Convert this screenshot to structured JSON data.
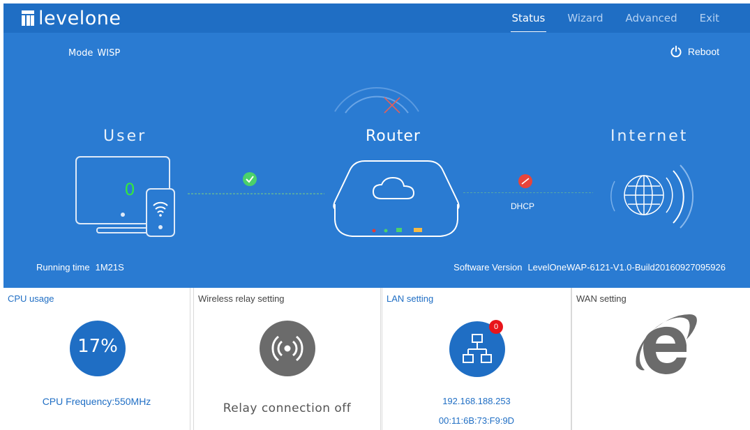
{
  "brand": {
    "name": "levelone"
  },
  "nav": {
    "items": [
      "Status",
      "Wizard",
      "Advanced",
      "Exit"
    ],
    "active": "Status"
  },
  "status": {
    "mode_label": "Mode",
    "mode_value": "WISP",
    "reboot_label": "Reboot",
    "user_label": "User",
    "router_label": "Router",
    "internet_label": "Internet",
    "user_count": "0",
    "wan_protocol": "DHCP",
    "running_time_label": "Running time",
    "running_time_value": "1M21S",
    "software_version_label": "Software Version",
    "software_version_value": "LevelOneWAP-6121-V1.0-Build20160927095926"
  },
  "connection_status": {
    "user_router": "connected",
    "router_internet": "disconnected",
    "colors": {
      "ok": "#4bd16b",
      "fail": "#e8443a"
    }
  },
  "panels": {
    "cpu": {
      "title": "CPU usage",
      "percent_text": "17%",
      "percent": 17,
      "frequency": "CPU Frequency:550MHz"
    },
    "relay": {
      "title": "Wireless relay setting",
      "status": "Relay connection off"
    },
    "lan": {
      "title": "LAN setting",
      "badge": "0",
      "ip": "192.168.188.253",
      "mac": "00:11:6B:73:F9:9D"
    },
    "wan": {
      "title": "WAN setting"
    }
  },
  "colors": {
    "hero_bg": "#2a7bd2",
    "topbar_bg": "#1f6ec4",
    "accent_blue": "#1f6ec4",
    "green_count": "#34e640"
  }
}
